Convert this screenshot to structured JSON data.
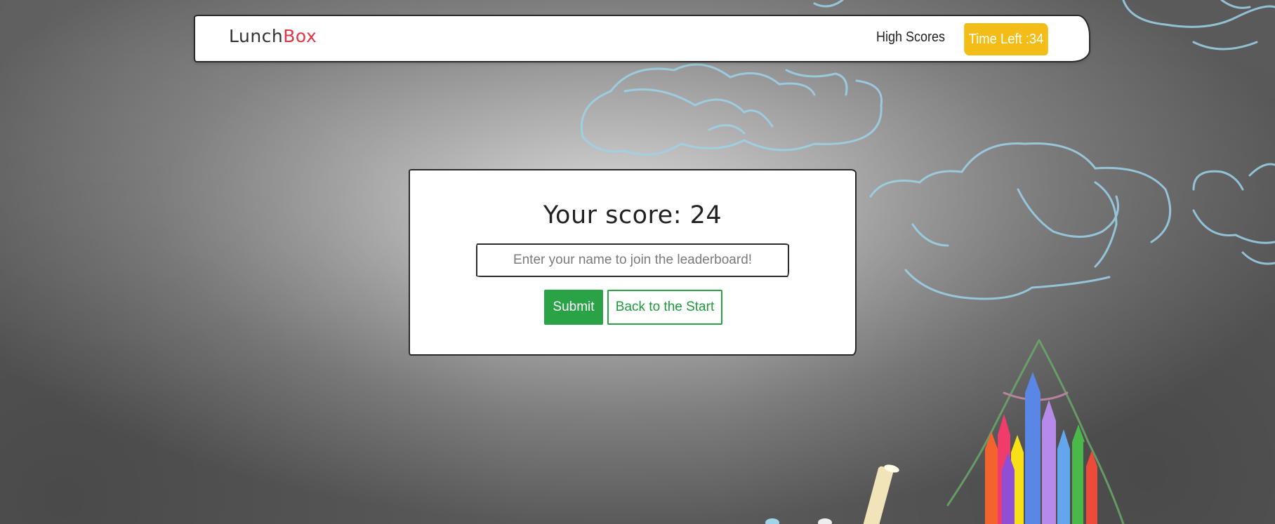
{
  "navbar": {
    "brand_part1": "Lunch",
    "brand_part2": "Box",
    "high_scores_label": "High Scores",
    "timer_label": "Time Left :34"
  },
  "score_card": {
    "title": "Your score: 24",
    "name_placeholder": "Enter your name to join the leaderboard!",
    "name_value": "",
    "submit_label": "Submit",
    "back_label": "Back to the Start"
  },
  "colors": {
    "brand_accent": "#e03645",
    "timer_bg": "#f2bd16",
    "success": "#2aa346"
  },
  "background": {
    "icons": [
      "chalk-cloud-icon",
      "crayons-icon",
      "chalk-stick-icon"
    ]
  }
}
